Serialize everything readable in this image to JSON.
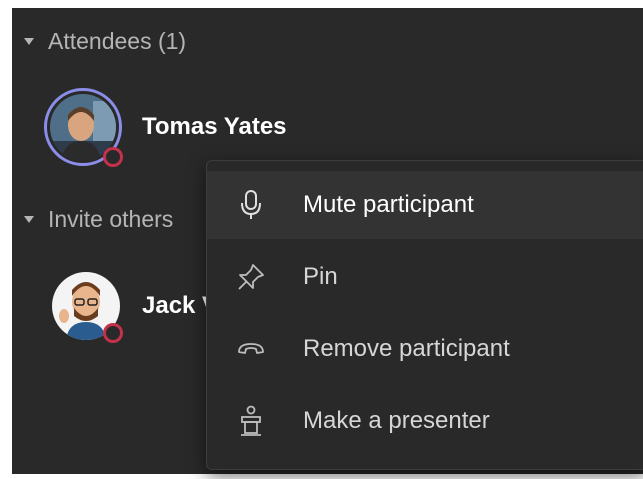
{
  "attendees_section": {
    "label": "Attendees (1)"
  },
  "invite_section": {
    "label": "Invite others"
  },
  "attendees": [
    {
      "name": "Tomas Yates",
      "status": "busy"
    }
  ],
  "invitees": [
    {
      "name": "Jack V",
      "status": "busy"
    }
  ],
  "context_menu": {
    "items": [
      {
        "label": "Mute participant",
        "icon": "microphone-icon"
      },
      {
        "label": "Pin",
        "icon": "pin-icon"
      },
      {
        "label": "Remove participant",
        "icon": "hang-up-icon"
      },
      {
        "label": "Make a presenter",
        "icon": "podium-icon"
      }
    ]
  },
  "colors": {
    "panel_bg": "#292929",
    "avatar_ring": "#8b8ee8",
    "status_busy": "#c4314b"
  }
}
